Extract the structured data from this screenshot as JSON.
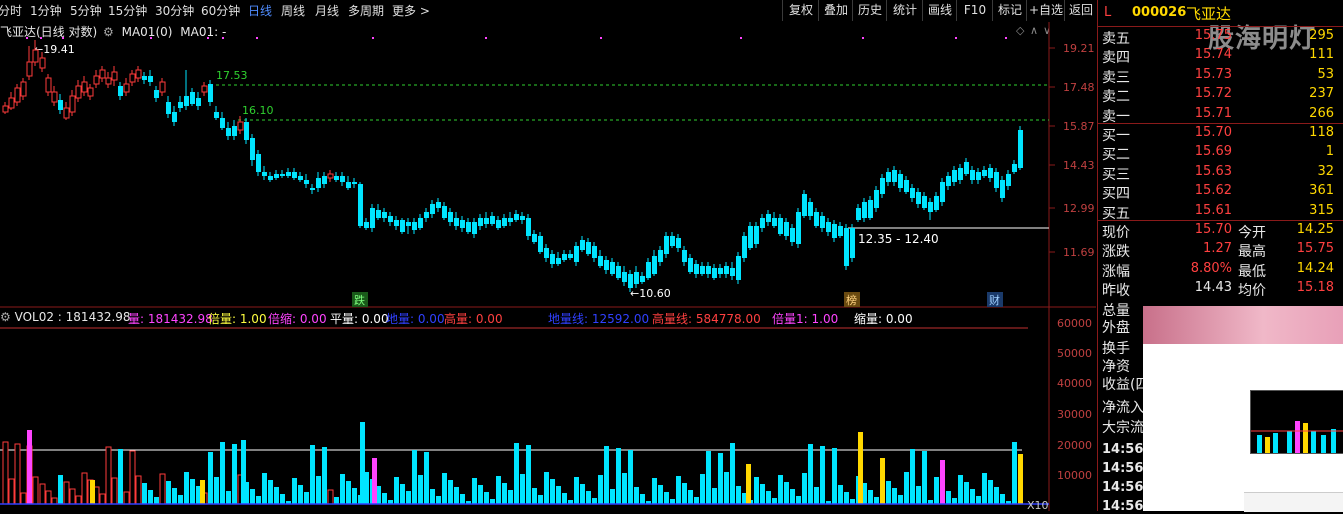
{
  "toolbar": {
    "periods": [
      "分时",
      "1分钟",
      "5分钟",
      "15分钟",
      "30分钟",
      "60分钟",
      "日线",
      "周线",
      "月线",
      "多周期",
      "更多 >"
    ],
    "active_period": "日线",
    "buttons": [
      "复权",
      "叠加",
      "历史",
      "统计",
      "画线",
      "F10",
      "标记",
      "+自选",
      "返回"
    ]
  },
  "chart_header": {
    "title": "飞亚达(日线 对数)",
    "indicator": "MA01(0)",
    "indicator_value": "MA01: -"
  },
  "price_axis": [
    "19.21",
    "17.48",
    "15.87",
    "14.43",
    "12.99",
    "11.69"
  ],
  "annotations": {
    "high_label": "19.41",
    "low_label": "10.60",
    "line1": "17.53",
    "line2": "16.10",
    "range_label": "12.35 - 12.40",
    "tag_die": "跌",
    "tag_bang": "榜",
    "tag_cai": "财"
  },
  "volume_header": {
    "name": "VOL02 : 181432.98",
    "items": [
      {
        "label": "量:",
        "value": "181432.98",
        "color": "#ff44ff"
      },
      {
        "label": "倍量:",
        "value": "1.00",
        "color": "#ffff40"
      },
      {
        "label": "倍缩:",
        "value": "0.00",
        "color": "#ff44ff"
      },
      {
        "label": "平量:",
        "value": "0.00",
        "color": "#ffffff"
      },
      {
        "label": "地量:",
        "value": "0.00",
        "color": "#3040ff"
      },
      {
        "label": "高量:",
        "value": "0.00",
        "color": "#ff4040"
      },
      {
        "label": "地量线:",
        "value": "12592.00",
        "color": "#3040ff"
      },
      {
        "label": "高量线:",
        "value": "584778.00",
        "color": "#ff4040"
      },
      {
        "label": "倍量1:",
        "value": "1.00",
        "color": "#ff44ff"
      },
      {
        "label": "缩量:",
        "value": "0.00",
        "color": "#ffffff"
      }
    ]
  },
  "volume_axis": [
    "60000",
    "50000",
    "40000",
    "30000",
    "20000",
    "10000"
  ],
  "volume_unit": "X10",
  "quote": {
    "flag": "L",
    "code": "000026",
    "name": "飞亚达",
    "watermark": "股海明灯",
    "asks": [
      {
        "label": "卖五",
        "price": "15.75",
        "vol": "295"
      },
      {
        "label": "卖四",
        "price": "15.74",
        "vol": "111"
      },
      {
        "label": "卖三",
        "price": "15.73",
        "vol": "53"
      },
      {
        "label": "卖二",
        "price": "15.72",
        "vol": "237"
      },
      {
        "label": "卖一",
        "price": "15.71",
        "vol": "266"
      }
    ],
    "bids": [
      {
        "label": "买一",
        "price": "15.70",
        "vol": "118"
      },
      {
        "label": "买二",
        "price": "15.69",
        "vol": "1"
      },
      {
        "label": "买三",
        "price": "15.63",
        "vol": "32"
      },
      {
        "label": "买四",
        "price": "15.62",
        "vol": "361"
      },
      {
        "label": "买五",
        "price": "15.61",
        "vol": "315"
      }
    ],
    "stats": [
      {
        "l1": "现价",
        "v1": "15.70",
        "c1": "#ff4040",
        "l2": "今开",
        "v2": "14.25",
        "c2": "#ffd800"
      },
      {
        "l1": "涨跌",
        "v1": "1.27",
        "c1": "#ff4040",
        "l2": "最高",
        "v2": "15.75",
        "c2": "#ff4040"
      },
      {
        "l1": "涨幅",
        "v1": "8.80%",
        "c1": "#ff4040",
        "l2": "最低",
        "v2": "14.24",
        "c2": "#ffd800"
      },
      {
        "l1": "昨收",
        "v1": "14.43",
        "c1": "#e8e8e8",
        "l2": "均价",
        "v2": "15.18",
        "c2": "#ff4040"
      },
      {
        "l1": "总量",
        "v1": "",
        "c1": "#ffd800",
        "l2": "",
        "v2": "",
        "c2": "#ffd800"
      }
    ],
    "more_labels": [
      "外盘",
      "换手",
      "净资",
      "收益(四",
      "净流入",
      "大宗流"
    ],
    "ticks": [
      "14:56",
      "14:56",
      "14:56",
      "14:56"
    ]
  },
  "colors": {
    "up": "#ff3b3b",
    "down": "#00e5ff",
    "axis": "#8a1a1a",
    "yellow": "#ffd800",
    "magenta": "#ff44ff"
  }
}
